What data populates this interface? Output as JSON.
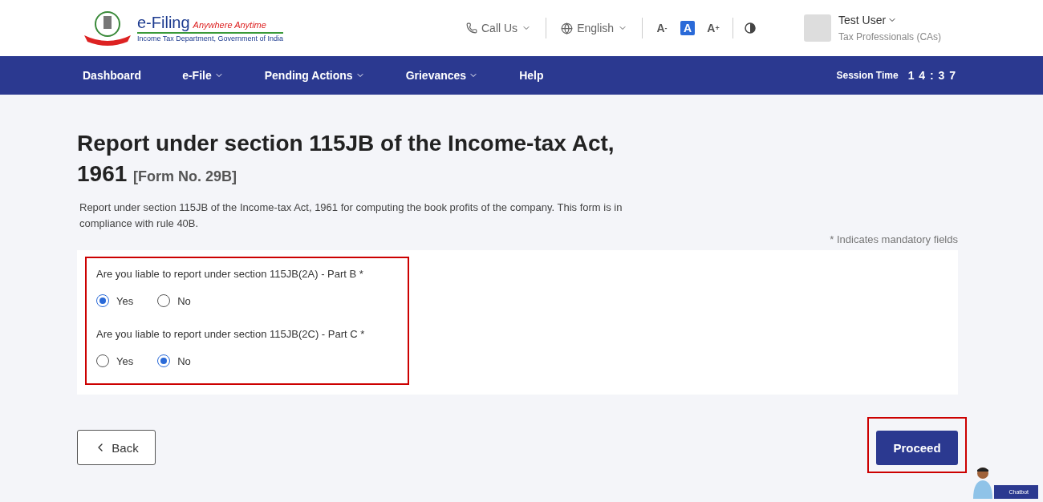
{
  "header": {
    "logo": {
      "title": "e-Filing",
      "tagline": "Anywhere Anytime",
      "subtitle": "Income Tax Department, Government of India"
    },
    "call_us": "Call Us",
    "language": "English",
    "font_sizes": [
      {
        "label": "A",
        "sup": "-",
        "selected": false
      },
      {
        "label": "A",
        "selected": true
      },
      {
        "label": "A",
        "sup": "+",
        "selected": false
      }
    ],
    "user": {
      "name": "Test User",
      "role": "Tax Professionals (CAs)"
    }
  },
  "nav": {
    "items": [
      {
        "label": "Dashboard",
        "dropdown": false
      },
      {
        "label": "e-File",
        "dropdown": true
      },
      {
        "label": "Pending Actions",
        "dropdown": true
      },
      {
        "label": "Grievances",
        "dropdown": true
      },
      {
        "label": "Help",
        "dropdown": false
      }
    ],
    "session_label": "Session Time",
    "session_time": "1 4 : 3 7"
  },
  "page": {
    "title": "Report under section 115JB of the Income-tax Act, 1961",
    "form_no": "[Form No. 29B]",
    "description": "Report under section 115JB of the Income-tax Act, 1961 for computing the book profits of the company. This form is in compliance with rule 40B.",
    "mandatory_note": "* Indicates mandatory fields"
  },
  "questions": [
    {
      "label": "Are you liable to report under section 115JB(2A) - Part B *",
      "options": [
        {
          "label": "Yes",
          "selected": true
        },
        {
          "label": "No",
          "selected": false
        }
      ]
    },
    {
      "label": "Are you liable to report under section 115JB(2C) - Part C *",
      "options": [
        {
          "label": "Yes",
          "selected": false
        },
        {
          "label": "No",
          "selected": true
        }
      ]
    }
  ],
  "buttons": {
    "back": "Back",
    "proceed": "Proceed"
  },
  "chatbot": "Chatbot"
}
